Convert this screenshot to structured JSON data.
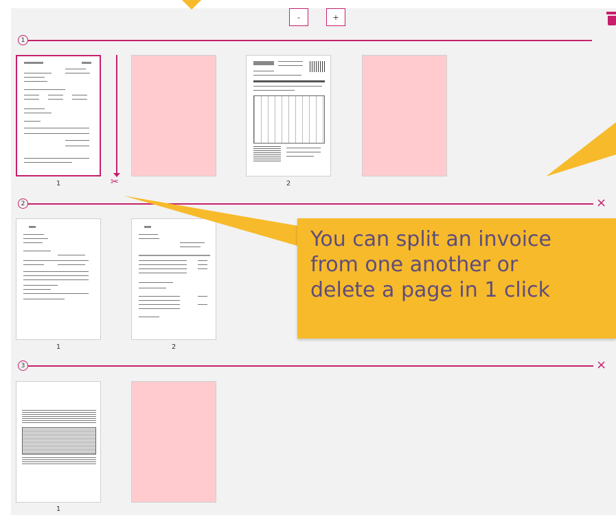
{
  "toolbar": {
    "zoom_out_label": "-",
    "zoom_in_label": "+"
  },
  "groups": [
    {
      "number": "1",
      "pages": [
        {
          "label": "1",
          "kind": "invoice",
          "selected": true
        },
        {
          "label": "",
          "kind": "blank"
        },
        {
          "label": "2",
          "kind": "invoice"
        },
        {
          "label": "",
          "kind": "blank"
        }
      ]
    },
    {
      "number": "2",
      "pages": [
        {
          "label": "1",
          "kind": "invoice"
        },
        {
          "label": "2",
          "kind": "invoice"
        }
      ]
    },
    {
      "number": "3",
      "pages": [
        {
          "label": "1",
          "kind": "invoice"
        },
        {
          "label": "",
          "kind": "blank"
        }
      ]
    }
  ],
  "remove_icon": "×",
  "scissors_icon": "✂",
  "tooltip": {
    "text": "You can split an invoice\nfrom one another or\ndelete a page in 1 click"
  },
  "colors": {
    "accent": "#c71f6b",
    "tooltip_bg": "#f7ba2a",
    "tooltip_text": "#5e4d7c",
    "blank_page": "#ffcbcf"
  }
}
